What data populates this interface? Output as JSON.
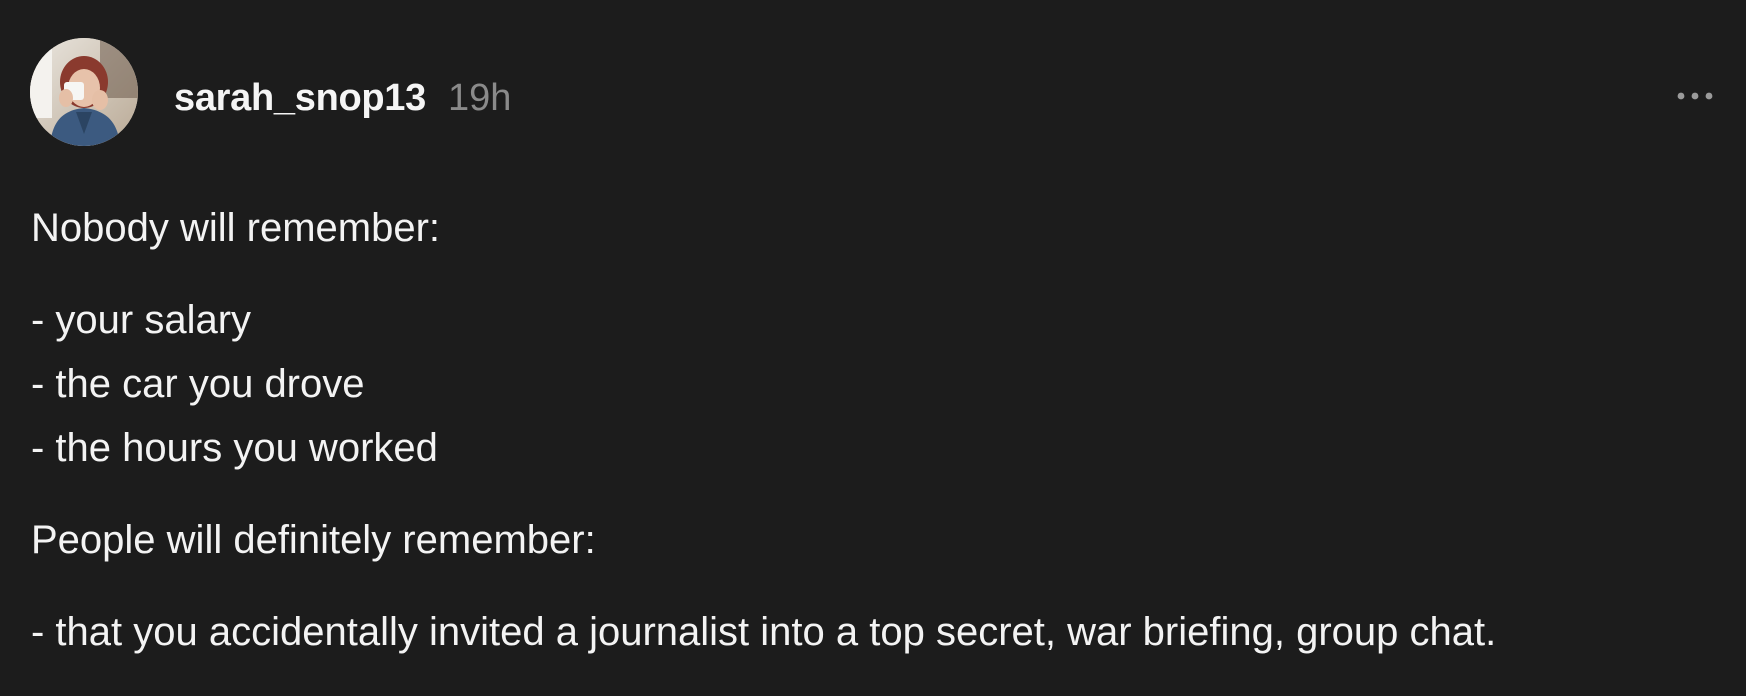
{
  "post": {
    "author": {
      "username": "sarah_snop13",
      "avatar_icon": "profile-photo-avatar"
    },
    "timestamp": "19h",
    "more_menu_icon": "more-horizontal-icon",
    "paragraphs": [
      {
        "lines": [
          "Nobody will remember:"
        ]
      },
      {
        "lines": [
          "- your salary",
          "- the car you drove",
          "- the hours you worked"
        ]
      },
      {
        "lines": [
          "People will definitely remember:"
        ]
      },
      {
        "lines": [
          "- that you accidentally invited a journalist into a top secret, war briefing, group chat."
        ]
      }
    ]
  },
  "colors": {
    "background": "#1c1c1c",
    "text_primary": "#f3f3f3",
    "text_secondary": "#8a8a8a",
    "icon_muted": "#9a9a9a"
  }
}
